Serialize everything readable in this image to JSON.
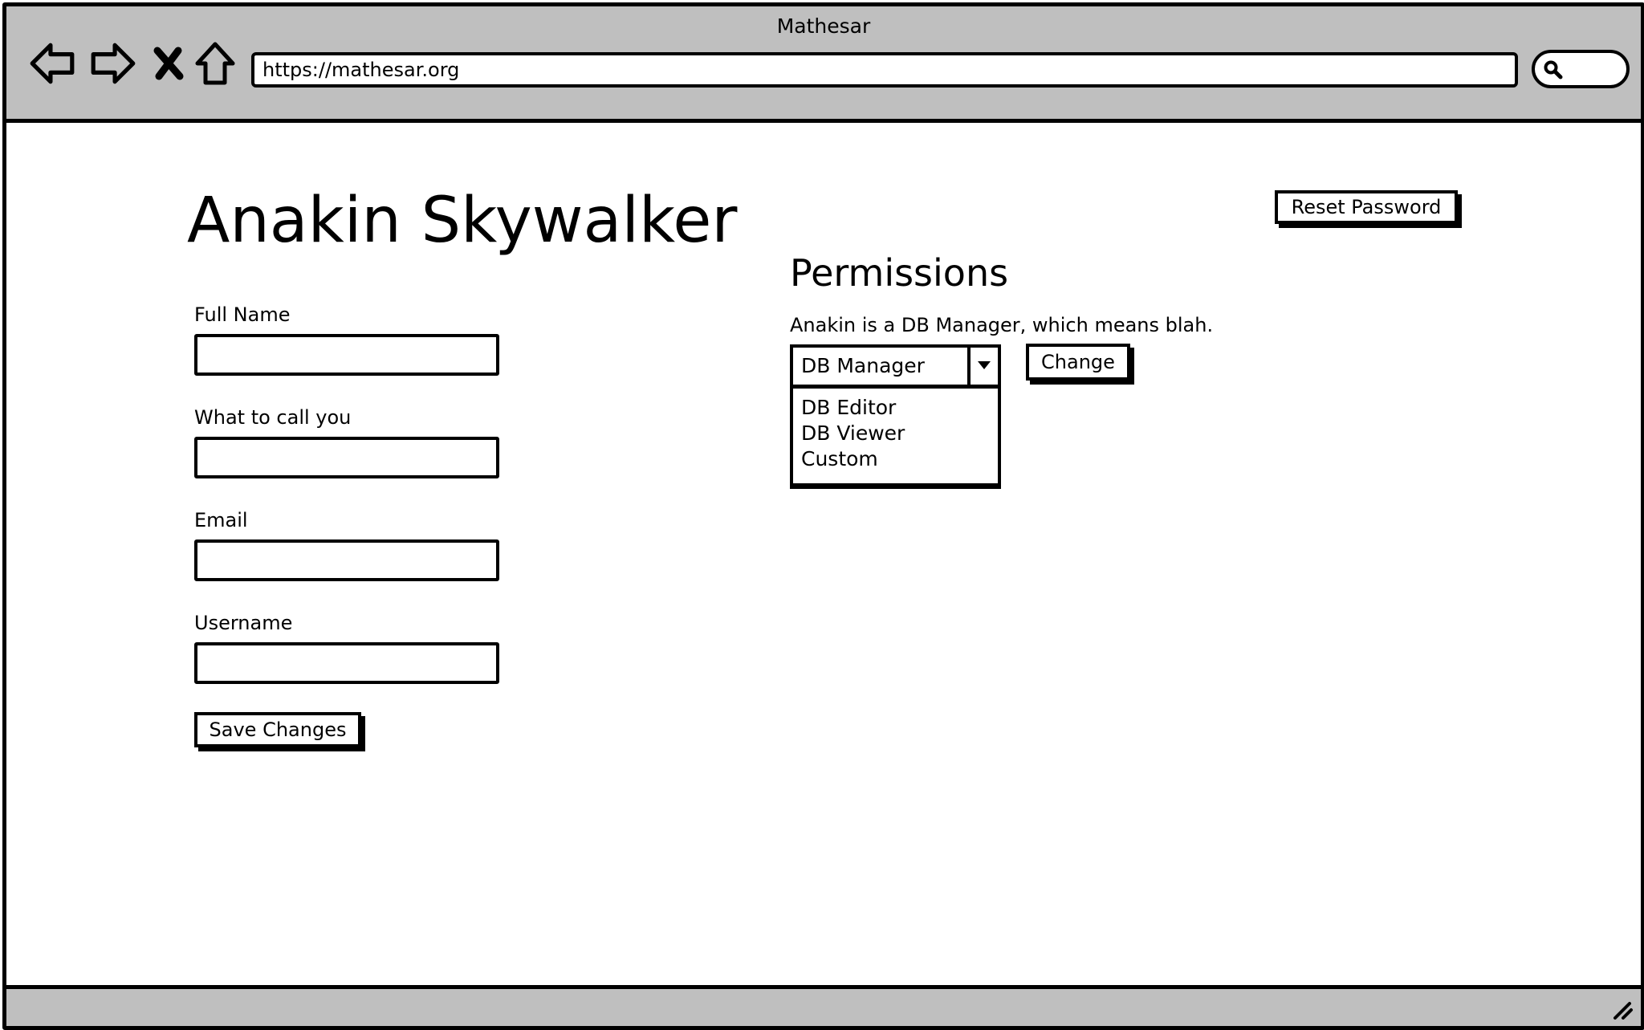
{
  "window": {
    "title": "Mathesar"
  },
  "toolbar": {
    "back_icon": "back-arrow-icon",
    "forward_icon": "forward-arrow-icon",
    "stop_icon": "close-icon",
    "home_icon": "home-icon",
    "url": "https://mathesar.org",
    "search_icon": "search-icon"
  },
  "user": {
    "name": "Anakin Skywalker"
  },
  "profile_form": {
    "fields": [
      {
        "label": "Full Name",
        "value": ""
      },
      {
        "label": "What to call you",
        "value": ""
      },
      {
        "label": "Email",
        "value": ""
      },
      {
        "label": "Username",
        "value": ""
      }
    ],
    "save_label": "Save Changes"
  },
  "actions": {
    "reset_password_label": "Reset Password"
  },
  "permissions": {
    "title": "Permissions",
    "description": "Anakin is a DB Manager, which means blah.",
    "selected_role": "DB Manager",
    "options": [
      "DB Editor",
      "DB Viewer",
      "Custom"
    ],
    "change_label": "Change"
  },
  "statusbar": {
    "resize_icon": "resize-grip-icon"
  }
}
